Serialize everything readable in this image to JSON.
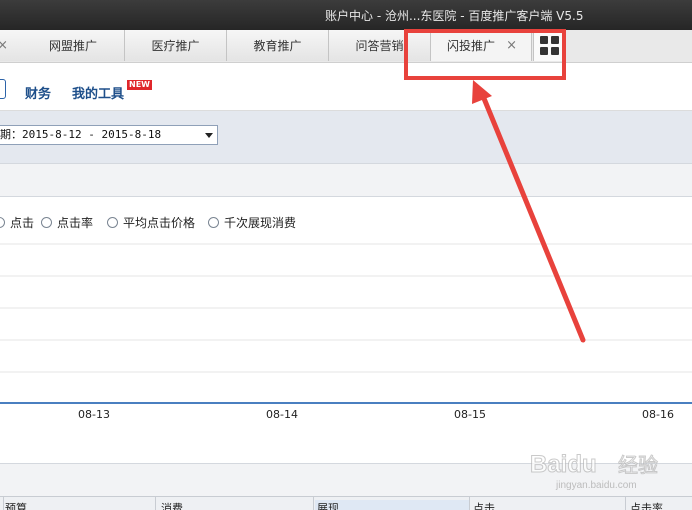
{
  "window": {
    "title": "账户中心 - 沧州...东医院 - 百度推广客户端 V5.5"
  },
  "tabs": [
    {
      "label": "网盟推广"
    },
    {
      "label": "医疗推广"
    },
    {
      "label": "教育推广"
    },
    {
      "label": "问答营销"
    },
    {
      "label": "闪投推广",
      "close": "×"
    }
  ],
  "nav": {
    "finance": "财务",
    "tools": "我的工具",
    "tools_badge": "NEW"
  },
  "filter": {
    "date_range": "期：2015-8-12 - 2015-8-18"
  },
  "metrics": [
    {
      "label": "点击"
    },
    {
      "label": "点击率"
    },
    {
      "label": "平均点击价格"
    },
    {
      "label": "千次展现消费"
    }
  ],
  "chart_data": {
    "type": "line",
    "categories": [
      "08-13",
      "08-14",
      "08-15",
      "08-16"
    ],
    "series": [],
    "grid": true
  },
  "table": {
    "headers": [
      "预算",
      "消费",
      "展现",
      "点击",
      "点击率"
    ]
  },
  "watermark": {
    "brand": "Baidu",
    "sub": "经验",
    "url": "jingyan.baidu.com"
  },
  "colors": {
    "annotation": "#e8423c",
    "nav_text": "#1e4f8a",
    "badge": "#e0262b"
  }
}
